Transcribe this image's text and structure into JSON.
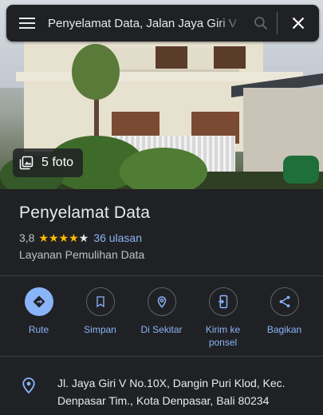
{
  "search": {
    "query": "Penyelamat Data, Jalan Jaya Giri V"
  },
  "photos": {
    "count_label": "5 foto"
  },
  "place": {
    "title": "Penyelamat Data",
    "rating": "3,8",
    "rating_value": 3.8,
    "stars_total": 5,
    "reviews_label": "36 ulasan",
    "category": "Layanan Pemulihan Data"
  },
  "actions": [
    {
      "label": "Rute",
      "icon": "directions-icon"
    },
    {
      "label": "Simpan",
      "icon": "bookmark-icon"
    },
    {
      "label": "Di Sekitar",
      "icon": "nearby-icon"
    },
    {
      "label": "Kirim ke ponsel",
      "icon": "send-to-phone-icon"
    },
    {
      "label": "Bagikan",
      "icon": "share-icon"
    }
  ],
  "address": {
    "text": "Jl. Jaya Giri V No.10X, Dangin Puri Klod, Kec. Denpasar Tim., Kota Denpasar, Bali 80234"
  },
  "colors": {
    "background": "#202124",
    "accent": "#8ab4f8",
    "star": "#fbbc04",
    "text": "#e8eaed",
    "muted": "#bdc1c6"
  }
}
